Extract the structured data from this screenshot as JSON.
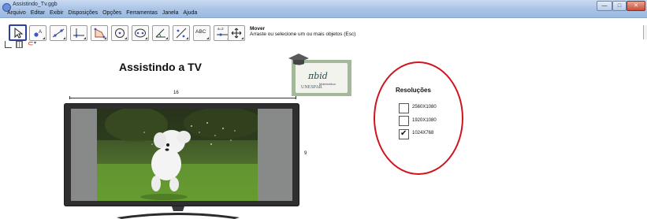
{
  "window": {
    "title": "Assistindo_Tv.ggb",
    "minimize": "—",
    "maximize": "□",
    "close": "✕"
  },
  "menu": [
    "Arquivo",
    "Editar",
    "Exibir",
    "Disposições",
    "Opções",
    "Ferramentas",
    "Janela",
    "Ajuda"
  ],
  "toolbar": {
    "tools": [
      {
        "name": "move-tool",
        "label": ""
      },
      {
        "name": "point-tool",
        "label": ""
      },
      {
        "name": "line-tool",
        "label": ""
      },
      {
        "name": "perpendicular-tool",
        "label": ""
      },
      {
        "name": "polygon-tool",
        "label": ""
      },
      {
        "name": "circle-tool",
        "label": ""
      },
      {
        "name": "conic-tool",
        "label": ""
      },
      {
        "name": "angle-tool",
        "label": ""
      },
      {
        "name": "reflect-tool",
        "label": ""
      },
      {
        "name": "text-tool",
        "label": "ABC"
      },
      {
        "name": "slider-tool",
        "label": "a=2"
      },
      {
        "name": "move-view-tool",
        "label": ""
      }
    ],
    "active_tool_name": "Mover",
    "active_tool_desc": "Arraste ou selecione um ou mais objetos (Esc)"
  },
  "canvas": {
    "title": "Assistindo a TV",
    "logo": {
      "text": "πbid",
      "subtitle": "Matemática",
      "institution": "UNESPAR"
    },
    "tv": {
      "width_label": "16",
      "height_label": "9"
    },
    "resolutions": {
      "title": "Resoluções",
      "options": [
        {
          "label": "2560X1080",
          "checked": false
        },
        {
          "label": "1920X1080",
          "checked": false
        },
        {
          "label": "1024X768",
          "checked": true
        }
      ]
    }
  },
  "colors": {
    "titlebar": "#a9c3e6",
    "ellipse": "#d0141c",
    "tool_selected_border": "#2c3f9a",
    "tv_frame": "#2f2f31"
  }
}
